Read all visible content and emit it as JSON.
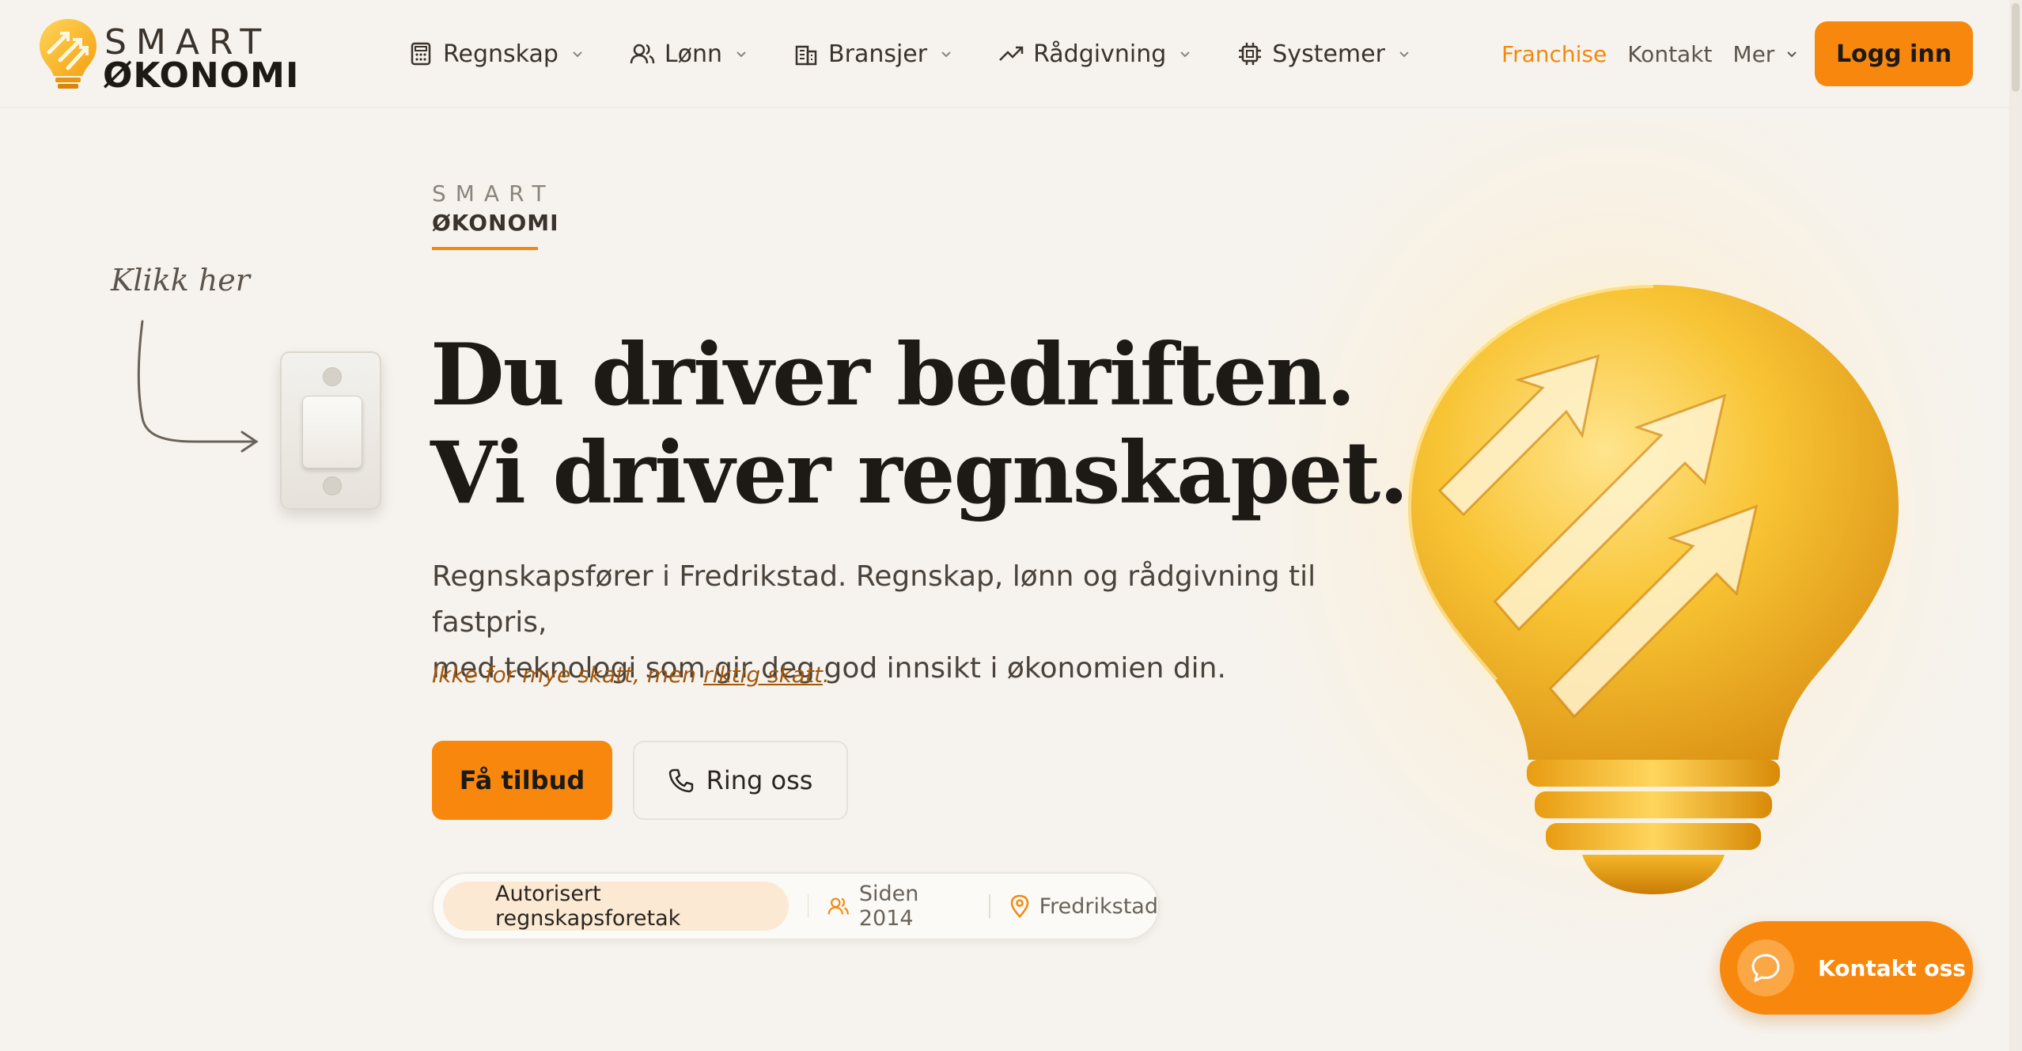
{
  "brand": {
    "logo_line1": "SMART",
    "logo_line2": "ØKONOMI",
    "accent_color": "#f8880d"
  },
  "nav": {
    "items": [
      {
        "label": "Regnskap",
        "icon": "calculator-icon"
      },
      {
        "label": "Lønn",
        "icon": "users-icon"
      },
      {
        "label": "Bransjer",
        "icon": "building-icon"
      },
      {
        "label": "Rådgivning",
        "icon": "trending-up-icon"
      },
      {
        "label": "Systemer",
        "icon": "cpu-icon"
      }
    ],
    "franchise": "Franchise",
    "kontakt": "Kontakt",
    "mer": "Mer",
    "login": "Logg inn"
  },
  "hero": {
    "eyebrow_line1": "SMART",
    "eyebrow_line2": "ØKONOMI",
    "klikk_her": "Klikk her",
    "headline_line1": "Du driver bedriften.",
    "headline_line2": "Vi driver regnskapet.",
    "subtitle_line1": "Regnskapsfører i Fredrikstad. Regnskap, lønn og rådgivning til fastpris,",
    "subtitle_line2": "med teknologi som gir deg god innsikt i økonomien din.",
    "tagline_pre": "Ikke for mye skatt, men ",
    "tagline_link": "riktig skatt",
    "tagline_post": ".",
    "cta_primary": "Få tilbud",
    "cta_secondary": "Ring oss"
  },
  "badges": {
    "authorized": "Autorisert regnskapsforetak",
    "since": "Siden 2014",
    "location": "Fredrikstad"
  },
  "chat": {
    "label": "Kontakt oss"
  }
}
